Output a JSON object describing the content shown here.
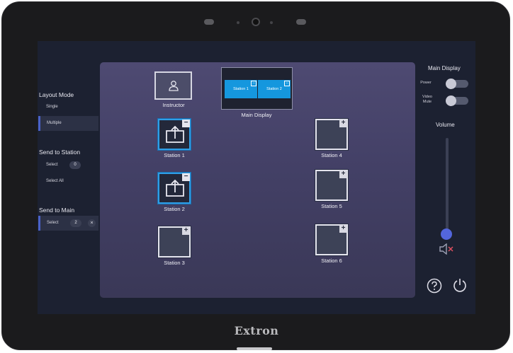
{
  "device": {
    "brand": "Extron"
  },
  "sidebar": {
    "layout_mode": {
      "title": "Layout Mode",
      "options": [
        "Single",
        "Multiple"
      ],
      "selected": "Multiple"
    },
    "send_to_station": {
      "title": "Send to Station",
      "select_label": "Select",
      "select_count": "0",
      "select_all_label": "Select All"
    },
    "send_to_main": {
      "title": "Send to Main",
      "select_label": "Select",
      "select_count": "2"
    }
  },
  "canvas": {
    "instructor_label": "Instructor",
    "main_display": {
      "label": "Main Display",
      "slots": [
        "Station 1",
        "Station 2"
      ]
    },
    "stations": [
      {
        "label": "Station 1",
        "state": "shared",
        "corner": "−"
      },
      {
        "label": "Station 2",
        "state": "shared",
        "corner": "−"
      },
      {
        "label": "Station 3",
        "state": "idle",
        "corner": "+"
      },
      {
        "label": "Station 4",
        "state": "idle",
        "corner": "+"
      },
      {
        "label": "Station 5",
        "state": "idle",
        "corner": "+"
      },
      {
        "label": "Station 6",
        "state": "idle",
        "corner": "+"
      }
    ]
  },
  "right_panel": {
    "title": "Main Display",
    "power_label": "Power",
    "video_mute_label": "Video Mute",
    "power_on": false,
    "video_mute_on": false,
    "volume_label": "Volume",
    "volume_level": 0.0
  },
  "colors": {
    "accent": "#2f9ee6",
    "slider": "#5366dd",
    "canvas": "#4a466d"
  },
  "icons": [
    "person-icon",
    "share-screen-icon",
    "mute-speaker-icon",
    "help-icon",
    "power-icon"
  ]
}
